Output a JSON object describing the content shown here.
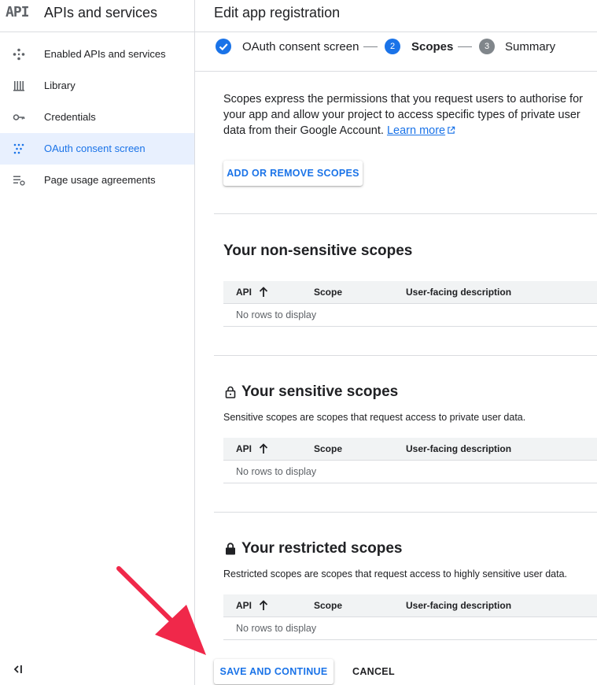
{
  "sidebar": {
    "logo": "API",
    "title": "APIs and services",
    "items": [
      {
        "label": "Enabled APIs and services",
        "icon": "diamond-dots-icon"
      },
      {
        "label": "Library",
        "icon": "library-icon"
      },
      {
        "label": "Credentials",
        "icon": "key-icon"
      },
      {
        "label": "OAuth consent screen",
        "icon": "oauth-dots-icon",
        "active": true
      },
      {
        "label": "Page usage agreements",
        "icon": "settings-list-icon"
      }
    ],
    "collapse_icon": "collapse-sidebar-icon"
  },
  "header": {
    "title": "Edit app registration"
  },
  "stepper": {
    "steps": [
      {
        "number": "1",
        "label": "OAuth consent screen",
        "state": "done"
      },
      {
        "number": "2",
        "label": "Scopes",
        "state": "current"
      },
      {
        "number": "3",
        "label": "Summary",
        "state": "pending"
      }
    ]
  },
  "intro": {
    "text": "Scopes express the permissions that you request users to authorise for your app and allow your project to access specific types of private user data from their Google Account.",
    "link": "Learn more"
  },
  "add_scopes_button": "ADD OR REMOVE SCOPES",
  "sections": [
    {
      "title": "Your non-sensitive scopes",
      "description": "",
      "columns": [
        "API",
        "Scope",
        "User-facing description"
      ],
      "empty_text": "No rows to display"
    },
    {
      "title": "Your sensitive scopes",
      "description": "Sensitive scopes are scopes that request access to private user data.",
      "columns": [
        "API",
        "Scope",
        "User-facing description"
      ],
      "empty_text": "No rows to display",
      "icon": "lock-open-icon"
    },
    {
      "title": "Your restricted scopes",
      "description": "Restricted scopes are scopes that request access to highly sensitive user data.",
      "columns": [
        "API",
        "Scope",
        "User-facing description"
      ],
      "empty_text": "No rows to display",
      "icon": "lock-icon"
    }
  ],
  "actions": {
    "save": "SAVE AND CONTINUE",
    "cancel": "CANCEL"
  },
  "colors": {
    "accent": "#1a73e8",
    "annotation_arrow": "#f0284a"
  }
}
